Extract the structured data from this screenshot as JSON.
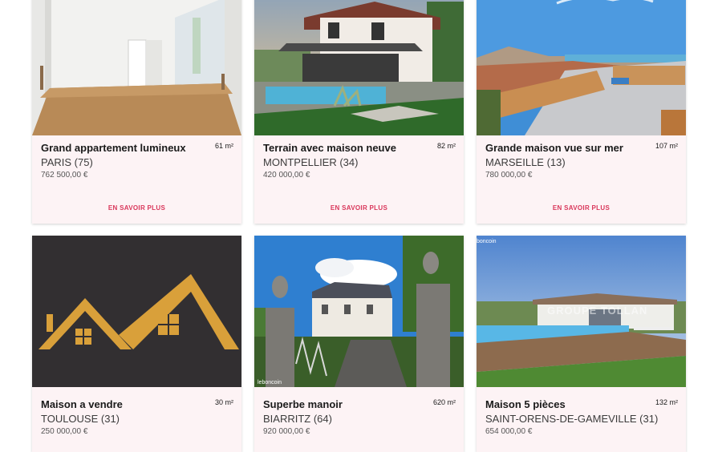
{
  "listings": [
    {
      "title": "Grand appartement lumineux",
      "area": "61 m²",
      "city": "PARIS (75)",
      "price": "762 500,00 €",
      "cta": "EN SAVOIR PLUS"
    },
    {
      "title": "Terrain avec maison neuve",
      "area": "82 m²",
      "city": "MONTPELLIER (34)",
      "price": "420 000,00 €",
      "cta": "EN SAVOIR PLUS"
    },
    {
      "title": "Grande maison vue sur mer",
      "area": "107 m²",
      "city": "MARSEILLE (13)",
      "price": "780 000,00 €",
      "cta": "EN SAVOIR PLUS"
    },
    {
      "title": "Maison a vendre",
      "area": "30 m²",
      "city": "TOULOUSE (31)",
      "price": "250 000,00 €"
    },
    {
      "title": "Superbe manoir",
      "area": "620 m²",
      "city": "BIARRITZ (64)",
      "price": "920 000,00 €",
      "watermark": "leboncoin"
    },
    {
      "title": "Maison 5 pièces",
      "area": "132 m²",
      "city": "SAINT-ORENS-DE-GAMEVILLE (31)",
      "price": "654 000,00 €",
      "watermark": "boncoin",
      "overlay_text": "GROUPE TOLLAN"
    }
  ]
}
